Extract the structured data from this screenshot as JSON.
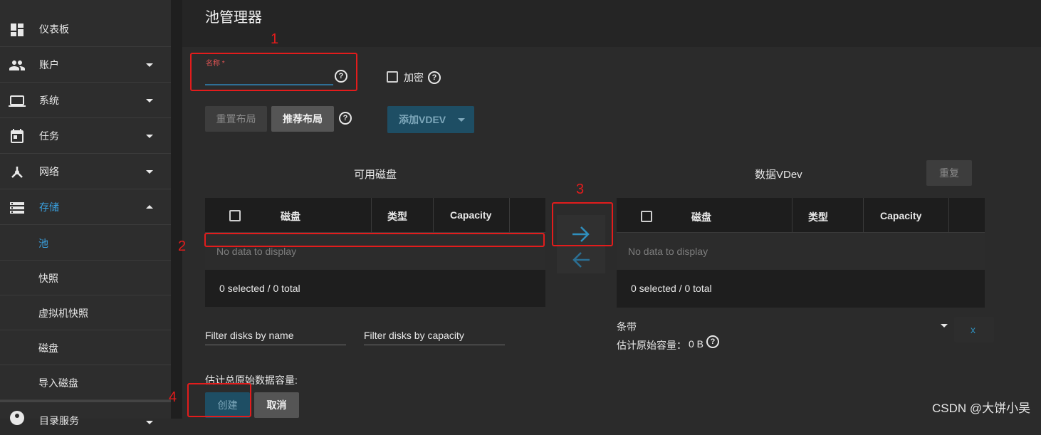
{
  "sidebar": {
    "items": [
      {
        "label": "仪表板",
        "icon": "dashboard-icon"
      },
      {
        "label": "账户",
        "icon": "people-icon"
      },
      {
        "label": "系统",
        "icon": "laptop-icon"
      },
      {
        "label": "任务",
        "icon": "calendar-icon"
      },
      {
        "label": "网络",
        "icon": "network-icon"
      },
      {
        "label": "存储",
        "icon": "storage-icon"
      }
    ],
    "storage_subitems": [
      "池",
      "快照",
      "虚拟机快照",
      "磁盘",
      "导入磁盘"
    ],
    "next_item": {
      "label": "目录服务",
      "icon": "directory-icon"
    }
  },
  "page": {
    "title": "池管理器"
  },
  "form": {
    "name_label": "名称 *",
    "name_value": "",
    "encrypt_label": "加密",
    "reset_layout": "重置布局",
    "suggest_layout": "推荐布局",
    "add_vdev": "添加VDEV"
  },
  "available_disks": {
    "title": "可用磁盘",
    "columns": [
      "磁盘",
      "类型",
      "Capacity"
    ],
    "empty_text": "No data to display",
    "footer": "0 selected / 0 total",
    "filter_name": "Filter disks by name",
    "filter_capacity": "Filter disks by capacity"
  },
  "data_vdev": {
    "title": "数据VDev",
    "repeat_label": "重复",
    "columns": [
      "磁盘",
      "类型",
      "Capacity"
    ],
    "empty_text": "No data to display",
    "footer": "0 selected / 0 total",
    "layout_value": "条带",
    "remove_label": "x",
    "raw_capacity_label": "估计原始容量：",
    "raw_capacity_value": "0 B"
  },
  "summary": {
    "total_label": "估计总原始数据容量:",
    "create": "创建",
    "cancel": "取消"
  },
  "annotations": [
    "1",
    "2",
    "3",
    "4"
  ],
  "watermark": "CSDN @大饼小吴",
  "colors": {
    "accent": "#3aa3e3",
    "annotation_red": "#e31c1c",
    "primary_button": "#1e4e64"
  }
}
